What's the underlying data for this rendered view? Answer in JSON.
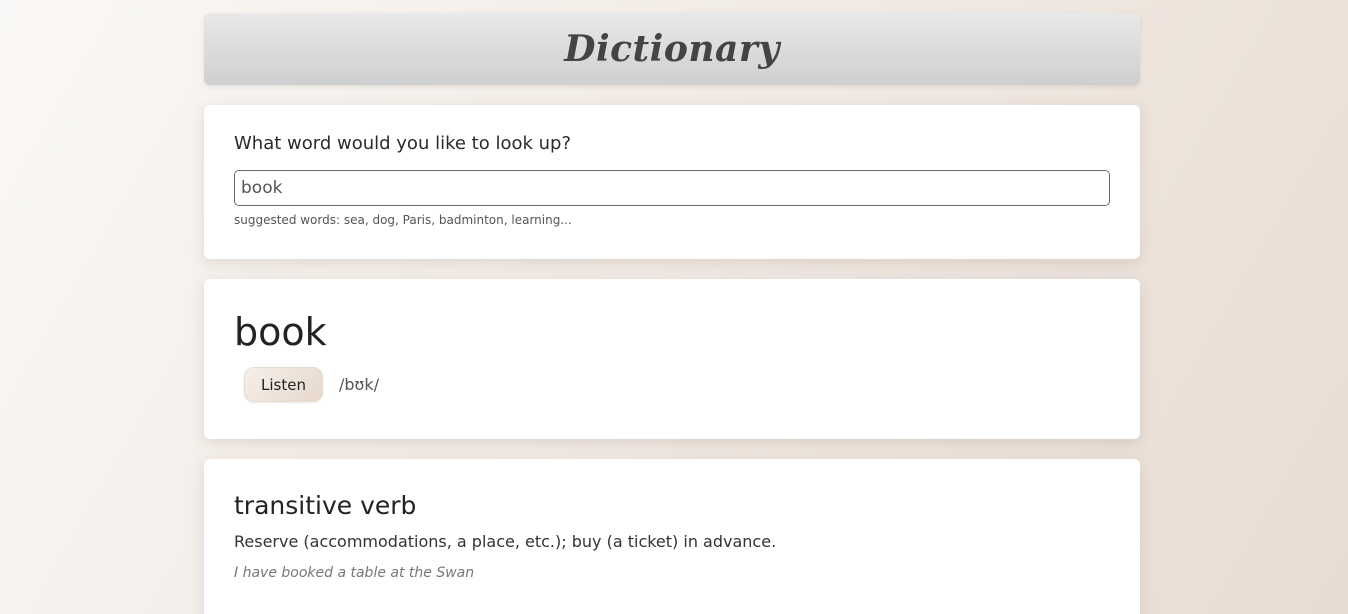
{
  "header": {
    "title": "Dictionary"
  },
  "search": {
    "prompt": "What word would you like to look up?",
    "value": "book",
    "hint": "suggested words: sea, dog, Paris, badminton, learning..."
  },
  "result": {
    "word": "book",
    "listen_label": "Listen",
    "phonetic": "/bʊk/"
  },
  "meanings": [
    {
      "part_of_speech": "transitive verb",
      "definition": "Reserve (accommodations, a place, etc.); buy (a ticket) in advance.",
      "example": "I have booked a table at the Swan"
    }
  ]
}
